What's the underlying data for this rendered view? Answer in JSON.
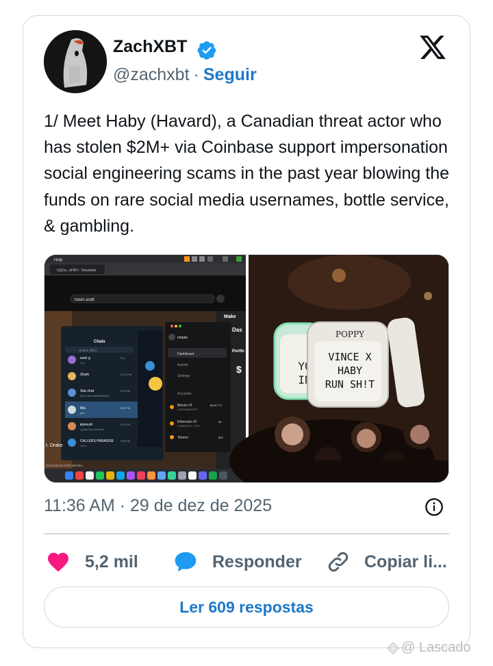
{
  "author": {
    "name": "ZachXBT",
    "handle": "@zachxbt",
    "separator": "·",
    "follow_label": "Seguir",
    "verified_icon": "verified-badge-icon",
    "verified_color": "#1d9bf0"
  },
  "platform_logo": "x-logo-icon",
  "tweet": {
    "text": "1/ Meet Haby (Havard), a Canadian threat actor who has stolen $2M+ via Coinbase support impersonation social engineering scams in the past year blowing the funds on rare social media usernames, bottle service, & gambling."
  },
  "media": {
    "left_screenshot": {
      "menu_label": "Help",
      "tab_label": "UQCe...zFRH - Tonviewer",
      "search_text": "travis scott",
      "chats_title": "Chats",
      "chats_search": "Search (⌘K)",
      "chats": [
        {
          "name": "work g",
          "preview": "You",
          "time": "Thu"
        },
        {
          "name": "Shark",
          "preview": "",
          "time": "12:51 PM"
        },
        {
          "name": "Star chat",
          "preview": "Win | MichaelSiddleAds",
          "time": "2:06 PM"
        },
        {
          "name": "Mia",
          "preview": "yoo",
          "time": "2:06 PM"
        },
        {
          "name": "ҝрзчнэй",
          "preview": "I gotta buy new shit",
          "time": "2:05 PM"
        },
        {
          "name": "CALLERS PARADISE",
          "preview": "LOLz",
          "time": "1:58 PM"
        }
      ],
      "wallet": {
        "account": "corpse",
        "nav": [
          "Dashboard",
          "Activity",
          "Settings"
        ],
        "accounts_label": "Accounts",
        "assets": [
          {
            "name": "Bitcoin #1",
            "value": "$249,773",
            "amount": "2.51313649 BTC"
          },
          {
            "name": "Ethereum #1",
            "value": "$0",
            "amount": "0.00000072...ETH"
          },
          {
            "name": "Tokens",
            "value": "$20",
            "amount": ""
          }
        ]
      },
      "side_labels": [
        "Make",
        "Das",
        "Portfo",
        "$"
      ],
      "caption": "#TravisScott #OfficialVideo",
      "drake_label": "t. Drake"
    },
    "right_photo": {
      "top_sign": "POPPY",
      "main_sign_lines": [
        "VINCE X",
        "HABY",
        "RUN SH!T"
      ],
      "left_sign_partial": [
        "YO",
        "IN"
      ]
    }
  },
  "timestamp": "11:36 AM · 29 de dez de 2025",
  "info_icon": "info-icon",
  "actions": [
    {
      "icon": "heart-icon",
      "label": "5,2 mil",
      "color": "#f91880"
    },
    {
      "icon": "reply-bubble-icon",
      "label": "Responder",
      "color": "#1d9bf0"
    },
    {
      "icon": "link-icon",
      "label": "Copiar li..."
    }
  ],
  "replies_button": "Ler 609 respostas",
  "watermark": "@ Lascado"
}
